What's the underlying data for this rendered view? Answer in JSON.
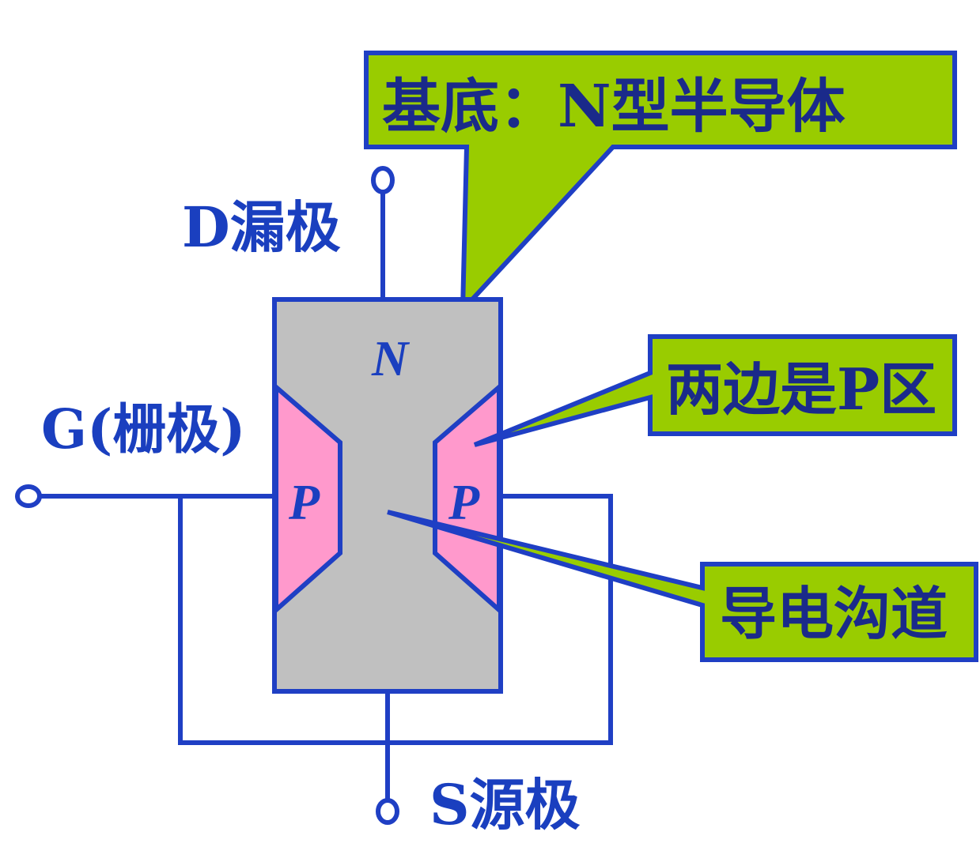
{
  "labels": {
    "drain": "D漏极",
    "gate": "G(栅极)",
    "source": "S源极"
  },
  "regions": {
    "n_region": "N",
    "p_left": "P",
    "p_right": "P"
  },
  "callouts": {
    "substrate": "基底：N型半导体",
    "p_regions": "两边是P区",
    "channel": "导电沟道"
  },
  "colors": {
    "line": "#1f3fc4",
    "substrate_fill": "#c0c0c0",
    "p_region_fill": "#ff99cc",
    "callout_fill": "#99cc00",
    "text": "#1a3fbf"
  }
}
